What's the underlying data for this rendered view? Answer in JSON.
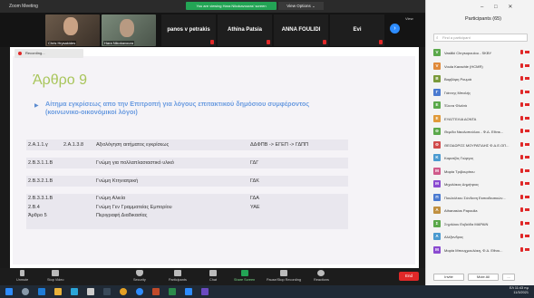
{
  "window": {
    "title": "Zoom Meeting"
  },
  "banner": {
    "text": "You are viewing Hara Nikokavouras' screen"
  },
  "view_options": {
    "label": "View Options ⌄"
  },
  "strip": {
    "videos": [
      {
        "name": "Chris Hrysakides"
      },
      {
        "name": "Hara Nikokavoura"
      }
    ],
    "names": [
      "panos v petrakis",
      "Athina Patsia",
      "ANNA FOULIDI",
      "Evi"
    ],
    "next_icon": "›",
    "view_label": "View"
  },
  "recording": {
    "label": "Recording..."
  },
  "slide": {
    "title": "Άρθρο 9",
    "subtitle": "Αίτημα εγκρίσεως απο την Επιτροπή για λόγους επιτακτικού δημόσιου συμφέροντος (κοινωνικο-οικονόμικοί λόγοι)",
    "rows": [
      {
        "a": "2.Α.1.1.γ",
        "b": "2.Α.1.3.8",
        "c": "Αξιολόγηση αιτήματος εγκρίσεως",
        "d": "ΔΔΦΠΒ -> ΕΓΕΠ -> ΓΔΠΠ"
      },
      {
        "a": "2.Β.3.1.1.Β",
        "b": "",
        "c": "Γνώμη για πολλαπλασιαστικό υλικό",
        "d": "ΓΔΓ"
      },
      {
        "a": "2.Β.3.2.1.Β",
        "b": "",
        "c": "Γνώμη Κτηνιατρική",
        "d": "ΓΔΚ"
      },
      {
        "a": "2.Β.3.3.1.Β",
        "b": "",
        "c": "Γνώμη Αλιεία",
        "d": "ΓΔΑ"
      },
      {
        "a": "2.Β.4",
        "b": "",
        "c": "Γνώμη Γεν Γραμματείας Εμπορίου",
        "d": "ΥΑΕ"
      },
      {
        "a": "Άρθρο 5",
        "b": "",
        "c": "Περιγραφή Διαδικασίας",
        "d": ""
      }
    ]
  },
  "toolbar": {
    "items": [
      {
        "label": "Unmute",
        "icon": "mic-icon"
      },
      {
        "label": "Stop Video",
        "icon": "camera-icon"
      },
      {
        "label": "Security",
        "icon": "shield-icon"
      },
      {
        "label": "Participants",
        "icon": "participants-icon"
      },
      {
        "label": "Chat",
        "icon": "chat-icon"
      },
      {
        "label": "Share Screen",
        "icon": "share-icon"
      },
      {
        "label": "Pause/Stop Recording",
        "icon": "record-icon"
      },
      {
        "label": "Reactions",
        "icon": "smile-icon"
      }
    ],
    "participants_count": "65",
    "end_label": "End"
  },
  "panel": {
    "title": "Participants (65)",
    "search_placeholder": "Find a participant",
    "participants": [
      {
        "initial": "V",
        "name": "Vasiliki Chrysopoulou - SKBY",
        "color": "#5aa84a"
      },
      {
        "initial": "V",
        "name": "Voula Karachle (HCMR)",
        "color": "#e08a3a"
      },
      {
        "initial": "Β",
        "name": "Βαρβάρη Ρουμιά",
        "color": "#7a9a3a"
      },
      {
        "initial": "Γ",
        "name": "Γιάννης Μπαλής",
        "color": "#4a7ad0"
      },
      {
        "initial": "Ε",
        "name": "Έλενα Φλεϊσά",
        "color": "#5aa84a"
      },
      {
        "initial": "Ε",
        "name": "ΕΥΑΓΓΕΛΙΑ ΔΟΝΤΑ",
        "color": "#e09a3a"
      },
      {
        "initial": "Θ",
        "name": "Θεμιδα Νικολοπούλου - Φ.Δ. Εθνικ...",
        "color": "#5aa84a"
      },
      {
        "initial": "Θ",
        "name": "ΘΕΟΔΩΡΟΣ ΜΟΥΡΑΤΙΔΗΣ Φ.Δ.Ε.ΟΠ...",
        "color": "#d04a4a"
      },
      {
        "initial": "Κ",
        "name": "Καρατζάς Γιώργος",
        "color": "#4a9ad0"
      },
      {
        "initial": "Μ",
        "name": "Μαρία Τριβουρίτου",
        "color": "#d05a8a"
      },
      {
        "initial": "Μ",
        "name": "Μιχαλάκος Δημήτριος",
        "color": "#8a4ad0"
      },
      {
        "initial": "Π",
        "name": "Πουλιάλτου Σύνδεση Εκπαιδευτικών...",
        "color": "#4a7ad0"
      },
      {
        "initial": "A",
        "name": "Athanasios Papoulia",
        "color": "#c09040"
      },
      {
        "initial": "Σ",
        "name": "Σηγιλάου Ευβιάδα ΜΑΡΑΙΝ",
        "color": "#5aa84a"
      },
      {
        "initial": "Α",
        "name": "Αλέξανδρος",
        "color": "#4a9ad0"
      },
      {
        "initial": "Μ",
        "name": "Μαρία Μπουχμουλάκη, Φ.Δ. Εθνικ...",
        "color": "#8a4ad0"
      }
    ],
    "invite_label": "Invite",
    "mute_all_label": "Mute All",
    "more_label": "..."
  },
  "taskbar": {
    "time": "11:43 πμ",
    "date": "11/3/2021",
    "lang": "ΕΛ"
  }
}
